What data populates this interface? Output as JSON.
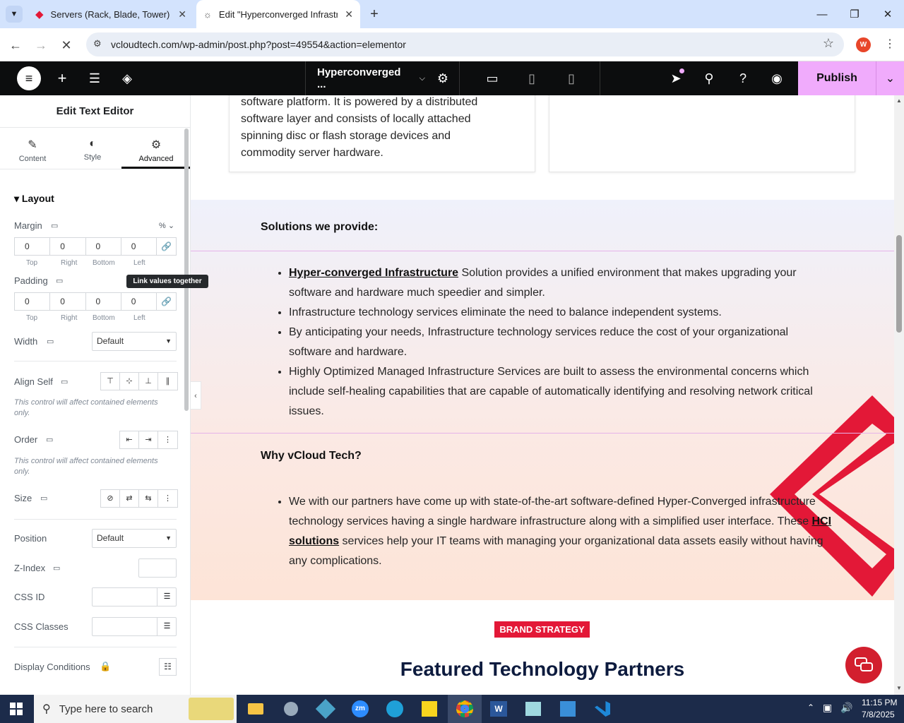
{
  "browser": {
    "tabs": [
      {
        "title": "Servers (Rack, Blade, Tower) - vC",
        "active": false
      },
      {
        "title": "Edit \"Hyperconverged Infrastru",
        "active": true
      }
    ],
    "url": "vcloudtech.com/wp-admin/post.php?post=49554&action=elementor",
    "profile_initial": "W"
  },
  "editor": {
    "page_title": "Hyperconverged ...",
    "publish_label": "Publish"
  },
  "panel": {
    "title": "Edit Text Editor",
    "tabs": [
      "Content",
      "Style",
      "Advanced"
    ],
    "section": "Layout",
    "margin": {
      "label": "Margin",
      "unit": "%",
      "values": [
        "0",
        "0",
        "0",
        "0"
      ],
      "sides": [
        "Top",
        "Right",
        "Bottom",
        "Left"
      ]
    },
    "padding": {
      "label": "Padding",
      "values": [
        "0",
        "0",
        "0",
        "0"
      ],
      "sides": [
        "Top",
        "Right",
        "Bottom",
        "Left"
      ]
    },
    "tooltip": "Link values together",
    "width": {
      "label": "Width",
      "value": "Default"
    },
    "align_self": "Align Self",
    "contained_note": "This control will affect contained elements only.",
    "order": "Order",
    "size": "Size",
    "position": {
      "label": "Position",
      "value": "Default"
    },
    "z_index": "Z-Index",
    "css_id": "CSS ID",
    "css_classes": "CSS Classes",
    "display_conditions": "Display Conditions"
  },
  "canvas": {
    "card_text": [
      "software platform. It is powered by a distributed",
      "software layer and consists of locally attached",
      "spinning disc or flash storage devices and",
      "commodity server hardware."
    ],
    "solutions_heading": "Solutions we provide:",
    "solutions": [
      {
        "link": "Hyper-converged Infrastructure",
        "text": " Solution provides a unified environment that makes upgrading your software and hardware much speedier and simpler."
      },
      {
        "link": "",
        "text": "Infrastructure technology services eliminate the need to balance independent systems."
      },
      {
        "link": "",
        "text": "By anticipating your needs, Infrastructure technology services reduce the cost of your organizational software and hardware."
      },
      {
        "link": "",
        "text": "Highly Optimized Managed Infrastructure Services are built to assess the environmental concerns which include self-healing capabilities that are capable of automatically identifying and resolving network critical issues."
      }
    ],
    "why_heading": "Why vCloud Tech?",
    "why_pre": "We with our partners have come up with state-of-the-art software-defined Hyper-Converged infrastructure technology services having a single hardware infrastructure along with a simplified user interface. These ",
    "why_link": "HCI solutions",
    "why_post": " services help your IT teams with managing your organizational data assets easily without having any complications.",
    "brand_badge": "BRAND STRATEGY",
    "featured_heading": "Featured Technology Partners",
    "accent_color": "#e31837"
  },
  "taskbar": {
    "search_placeholder": "Type here to search",
    "time": "11:15 PM",
    "date": "7/8/2025"
  }
}
